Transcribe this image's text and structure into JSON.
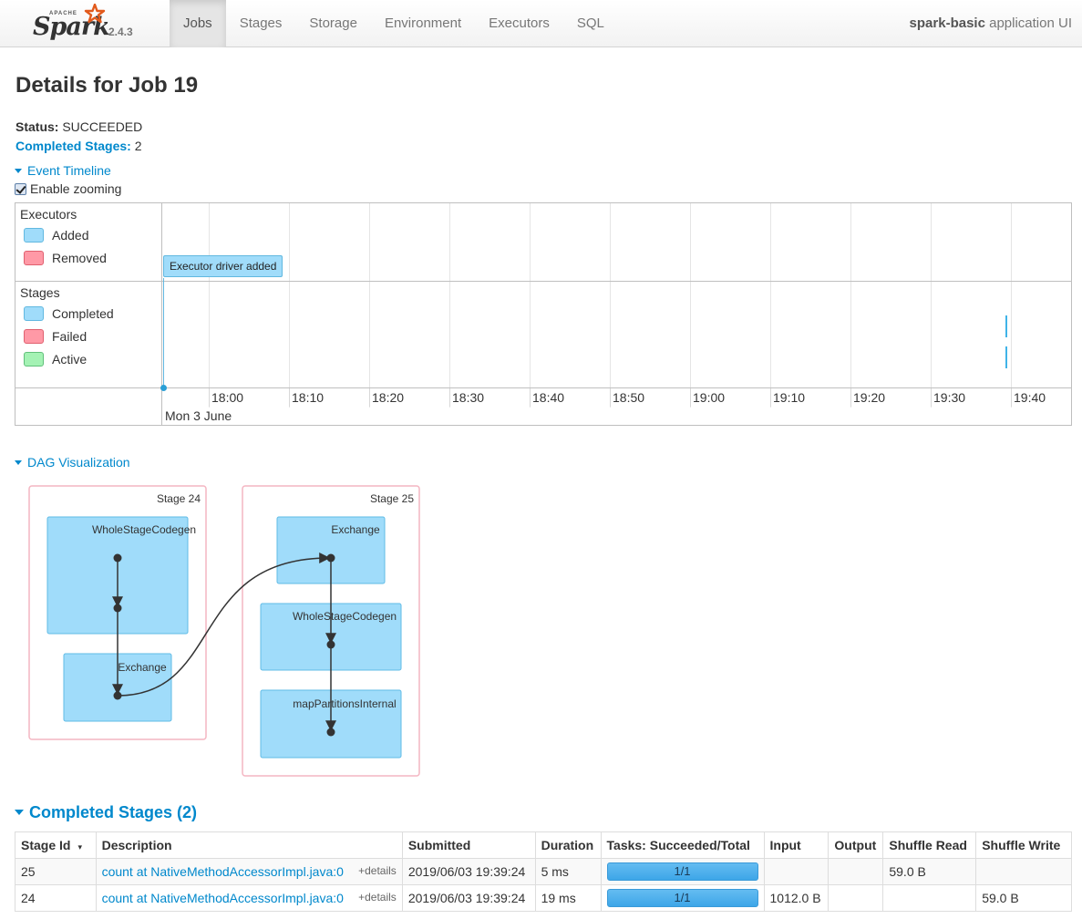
{
  "nav": {
    "brand_apache": "APACHE",
    "brand_name": "Spark",
    "version": "2.4.3",
    "tabs": [
      {
        "label": "Jobs",
        "active": true
      },
      {
        "label": "Stages"
      },
      {
        "label": "Storage"
      },
      {
        "label": "Environment"
      },
      {
        "label": "Executors"
      },
      {
        "label": "SQL"
      }
    ],
    "app_name": "spark-basic",
    "app_suffix": " application UI"
  },
  "page": {
    "title": "Details for Job 19",
    "status_label": "Status:",
    "status_value": "SUCCEEDED",
    "completed_label": "Completed Stages:",
    "completed_value": "2"
  },
  "timeline": {
    "toggle_label": "Event Timeline",
    "zoom_label": "Enable zooming",
    "groups": {
      "executors": {
        "title": "Executors",
        "legend": [
          "Added",
          "Removed"
        ]
      },
      "stages": {
        "title": "Stages",
        "legend": [
          "Completed",
          "Failed",
          "Active"
        ]
      }
    },
    "ticks": [
      "18:00",
      "18:10",
      "18:20",
      "18:30",
      "18:40",
      "18:50",
      "19:00",
      "19:10",
      "19:20",
      "19:30",
      "19:40"
    ],
    "date_label": "Mon 3 June",
    "executor_event": "Executor driver added"
  },
  "dag": {
    "toggle_label": "DAG Visualization",
    "stages": [
      {
        "label": "Stage 24",
        "nodes": [
          "WholeStageCodegen",
          "Exchange"
        ]
      },
      {
        "label": "Stage 25",
        "nodes": [
          "Exchange",
          "WholeStageCodegen",
          "mapPartitionsInternal"
        ]
      }
    ]
  },
  "completed_stages": {
    "header": "Completed Stages (2)",
    "columns": [
      "Stage Id",
      "Description",
      "Submitted",
      "Duration",
      "Tasks: Succeeded/Total",
      "Input",
      "Output",
      "Shuffle Read",
      "Shuffle Write"
    ],
    "details_label": "+details",
    "rows": [
      {
        "id": "25",
        "description": "count at NativeMethodAccessorImpl.java:0",
        "submitted": "2019/06/03 19:39:24",
        "duration": "5 ms",
        "tasks": "1/1",
        "tasks_fraction": 1.0,
        "input": "",
        "output": "",
        "shuffle_read": "59.0 B",
        "shuffle_write": ""
      },
      {
        "id": "24",
        "description": "count at NativeMethodAccessorImpl.java:0",
        "submitted": "2019/06/03 19:39:24",
        "duration": "19 ms",
        "tasks": "1/1",
        "tasks_fraction": 1.0,
        "input": "1012.0 B",
        "output": "",
        "shuffle_read": "",
        "shuffle_write": "59.0 B"
      }
    ]
  }
}
